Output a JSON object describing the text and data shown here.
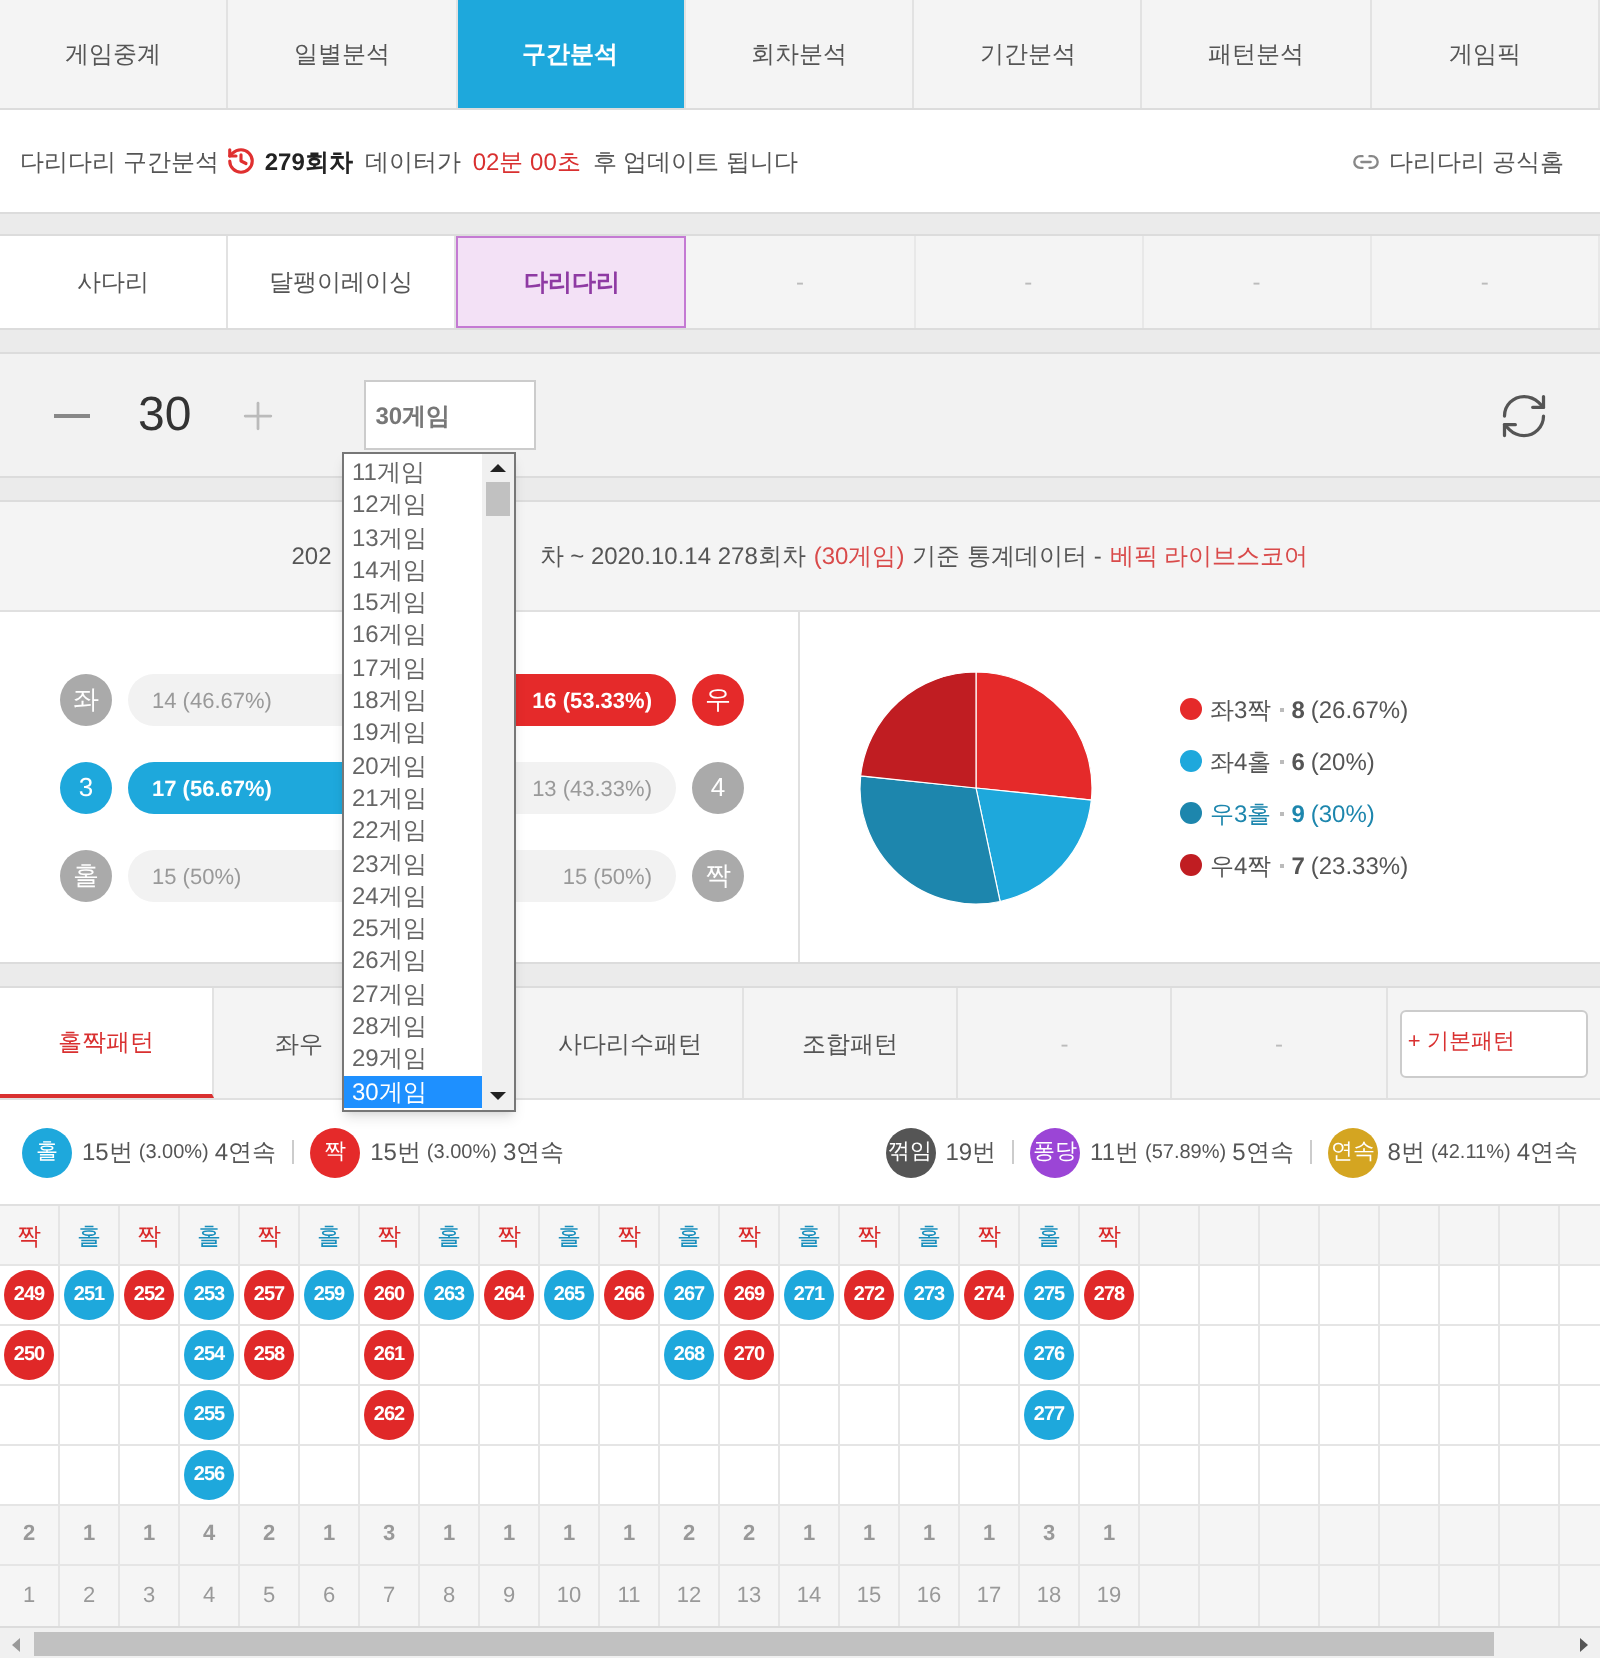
{
  "nav_tabs": [
    {
      "label": "게임중계",
      "selected": false
    },
    {
      "label": "일별분석",
      "selected": false
    },
    {
      "label": "구간분석",
      "selected": true
    },
    {
      "label": "회차분석",
      "selected": false
    },
    {
      "label": "기간분석",
      "selected": false
    },
    {
      "label": "패턴분석",
      "selected": false
    },
    {
      "label": "게임픽",
      "selected": false
    }
  ],
  "info_bar": {
    "game": "다리다리 구간분석",
    "round": "279회차",
    "text_before": "데이터가",
    "countdown": "02분 00초",
    "text_after": "후 업데이트 됩니다",
    "home_link": "다리다리 공식홈"
  },
  "game_tabs": [
    {
      "label": "사다리",
      "selected": false
    },
    {
      "label": "달팽이레이싱",
      "selected": false
    },
    {
      "label": "다리다리",
      "selected": true
    },
    {
      "label": "-",
      "selected": false
    },
    {
      "label": "-",
      "selected": false
    },
    {
      "label": "-",
      "selected": false
    },
    {
      "label": "-",
      "selected": false
    }
  ],
  "counter": {
    "value": "30"
  },
  "select": {
    "value": "30게임",
    "open": true,
    "options": [
      {
        "label": "11게임",
        "selected": false
      },
      {
        "label": "12게임",
        "selected": false
      },
      {
        "label": "13게임",
        "selected": false
      },
      {
        "label": "14게임",
        "selected": false
      },
      {
        "label": "15게임",
        "selected": false
      },
      {
        "label": "16게임",
        "selected": false
      },
      {
        "label": "17게임",
        "selected": false
      },
      {
        "label": "18게임",
        "selected": false
      },
      {
        "label": "19게임",
        "selected": false
      },
      {
        "label": "20게임",
        "selected": false
      },
      {
        "label": "21게임",
        "selected": false
      },
      {
        "label": "22게임",
        "selected": false
      },
      {
        "label": "23게임",
        "selected": false
      },
      {
        "label": "24게임",
        "selected": false
      },
      {
        "label": "25게임",
        "selected": false
      },
      {
        "label": "26게임",
        "selected": false
      },
      {
        "label": "27게임",
        "selected": false
      },
      {
        "label": "28게임",
        "selected": false
      },
      {
        "label": "29게임",
        "selected": false
      },
      {
        "label": "30게임",
        "selected": true
      }
    ]
  },
  "stats": {
    "header": {
      "lead": "202",
      "range": "차 ~ 2020.10.14 278회차",
      "games": "(30게임)",
      "basis": "기준 통계데이터 -",
      "source": "베픽 라이브스코어"
    },
    "bars": [
      {
        "left_label": "좌",
        "left_text": "14 (46.67%)",
        "right_label": "우",
        "right_text": "16 (53.33%)",
        "left_wins": false,
        "right_wins": true,
        "color": "#e52a2a",
        "level": 0.5333
      },
      {
        "left_label": "3",
        "left_text": "17 (56.67%)",
        "right_label": "4",
        "right_text": "13 (43.33%)",
        "left_wins": true,
        "right_wins": false,
        "color": "#1ea8dc",
        "level": 0.5667
      },
      {
        "left_label": "홀",
        "left_text": "15 (50%)",
        "right_label": "짝",
        "right_text": "15 (50%)",
        "left_wins": false,
        "right_wins": false
      }
    ],
    "legend": [
      {
        "label": "좌3짝",
        "count": "8",
        "pct": "(26.67%)",
        "color": "#e52a2a",
        "highlighted": false
      },
      {
        "label": "좌4홀",
        "count": "6",
        "pct": "(20%)",
        "color": "#1ea8dc",
        "highlighted": false
      },
      {
        "label": "우3홀",
        "count": "9",
        "pct": "(30%)",
        "color": "#1d86ad",
        "highlighted": true
      },
      {
        "label": "우4짝",
        "count": "7",
        "pct": "(23.33%)",
        "color": "#c01d22",
        "highlighted": false
      }
    ],
    "chart_data": {
      "type": "pie",
      "values": [
        26.67,
        20,
        30,
        23.33
      ]
    }
  },
  "pattern_tabs": [
    {
      "label": "홀짝패턴",
      "kind": "tab",
      "selected": true
    },
    {
      "label": "좌우",
      "kind": "tab",
      "selected": false
    },
    {
      "label": "사다리수패턴",
      "kind": "tab",
      "selected": false
    },
    {
      "label": "조합패턴",
      "kind": "tab",
      "selected": false
    },
    {
      "label": "-",
      "kind": "tab",
      "selected": false
    },
    {
      "label": "-",
      "kind": "tab",
      "selected": false
    },
    {
      "label": "+ 기본패턴",
      "kind": "button"
    }
  ],
  "summary": {
    "left": [
      {
        "badge": "홀",
        "color": "#1ea8dc",
        "count": "15번",
        "pct": "(3.00%)",
        "streak": "4연속"
      },
      {
        "badge": "짝",
        "color": "#e52a2a",
        "count": "15번",
        "pct": "(3.00%)",
        "streak": "3연속"
      }
    ],
    "right": [
      {
        "badge": "꺾임",
        "color": "#555555",
        "count": "19번"
      },
      {
        "badge": "퐁당",
        "color": "#9b45d6",
        "count": "11번",
        "pct": "(57.89%)",
        "streak": "5연속"
      },
      {
        "badge": "연속",
        "color": "#d4a521",
        "count": "8번",
        "pct": "(42.11%)",
        "streak": "4연속"
      }
    ]
  },
  "grid": {
    "columns": [
      {
        "label": "짝",
        "kind": "even",
        "balls": [
          "249",
          "250"
        ],
        "count": "2",
        "index": "1"
      },
      {
        "label": "홀",
        "kind": "odd",
        "balls": [
          "251"
        ],
        "count": "1",
        "index": "2"
      },
      {
        "label": "짝",
        "kind": "even",
        "balls": [
          "252"
        ],
        "count": "1",
        "index": "3"
      },
      {
        "label": "홀",
        "kind": "odd",
        "balls": [
          "253",
          "254",
          "255",
          "256"
        ],
        "count": "4",
        "index": "4"
      },
      {
        "label": "짝",
        "kind": "even",
        "balls": [
          "257",
          "258"
        ],
        "count": "2",
        "index": "5"
      },
      {
        "label": "홀",
        "kind": "odd",
        "balls": [
          "259"
        ],
        "count": "1",
        "index": "6"
      },
      {
        "label": "짝",
        "kind": "even",
        "balls": [
          "260",
          "261",
          "262"
        ],
        "count": "3",
        "index": "7"
      },
      {
        "label": "홀",
        "kind": "odd",
        "balls": [
          "263"
        ],
        "count": "1",
        "index": "8"
      },
      {
        "label": "짝",
        "kind": "even",
        "balls": [
          "264"
        ],
        "count": "1",
        "index": "9"
      },
      {
        "label": "홀",
        "kind": "odd",
        "balls": [
          "265"
        ],
        "count": "1",
        "index": "10"
      },
      {
        "label": "짝",
        "kind": "even",
        "balls": [
          "266"
        ],
        "count": "1",
        "index": "11"
      },
      {
        "label": "홀",
        "kind": "odd",
        "balls": [
          "267",
          "268"
        ],
        "count": "2",
        "index": "12"
      },
      {
        "label": "짝",
        "kind": "even",
        "balls": [
          "269",
          "270"
        ],
        "count": "2",
        "index": "13"
      },
      {
        "label": "홀",
        "kind": "odd",
        "balls": [
          "271"
        ],
        "count": "1",
        "index": "14"
      },
      {
        "label": "짝",
        "kind": "even",
        "balls": [
          "272"
        ],
        "count": "1",
        "index": "15"
      },
      {
        "label": "홀",
        "kind": "odd",
        "balls": [
          "273"
        ],
        "count": "1",
        "index": "16"
      },
      {
        "label": "짝",
        "kind": "even",
        "balls": [
          "274"
        ],
        "count": "1",
        "index": "17"
      },
      {
        "label": "홀",
        "kind": "odd",
        "balls": [
          "275",
          "276",
          "277"
        ],
        "count": "3",
        "index": "18"
      },
      {
        "label": "짝",
        "kind": "even",
        "balls": [
          "278"
        ],
        "count": "1",
        "index": "19"
      }
    ]
  }
}
